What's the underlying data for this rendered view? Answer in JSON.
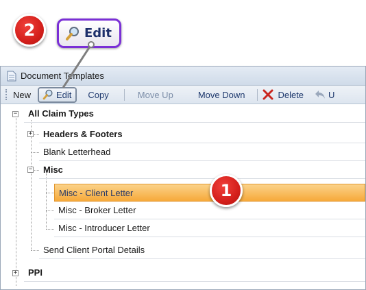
{
  "callouts": {
    "step2": "2",
    "step1": "1",
    "zoom_edit_label": "Edit"
  },
  "window": {
    "title": "Document Templates"
  },
  "toolbar": {
    "new_label": "New",
    "edit_label": "Edit",
    "copy_label": "Copy",
    "move_up_label": "Move Up",
    "move_down_label": "Move Down",
    "delete_label": "Delete",
    "undo_label": "U"
  },
  "tree": {
    "root": "All Claim Types",
    "headers_footers": "Headers & Footers",
    "blank_letterhead": "Blank Letterhead",
    "misc": "Misc",
    "misc_client": "Misc  - Client Letter",
    "misc_broker": "Misc - Broker Letter",
    "misc_introducer": "Misc  - Introducer Letter",
    "send_portal": "Send Client Portal Details",
    "ppi": "PPI"
  },
  "colors": {
    "callout_red": "#d41f1b",
    "zoom_border": "#7a2fd6",
    "selection": "#f6a93a"
  }
}
